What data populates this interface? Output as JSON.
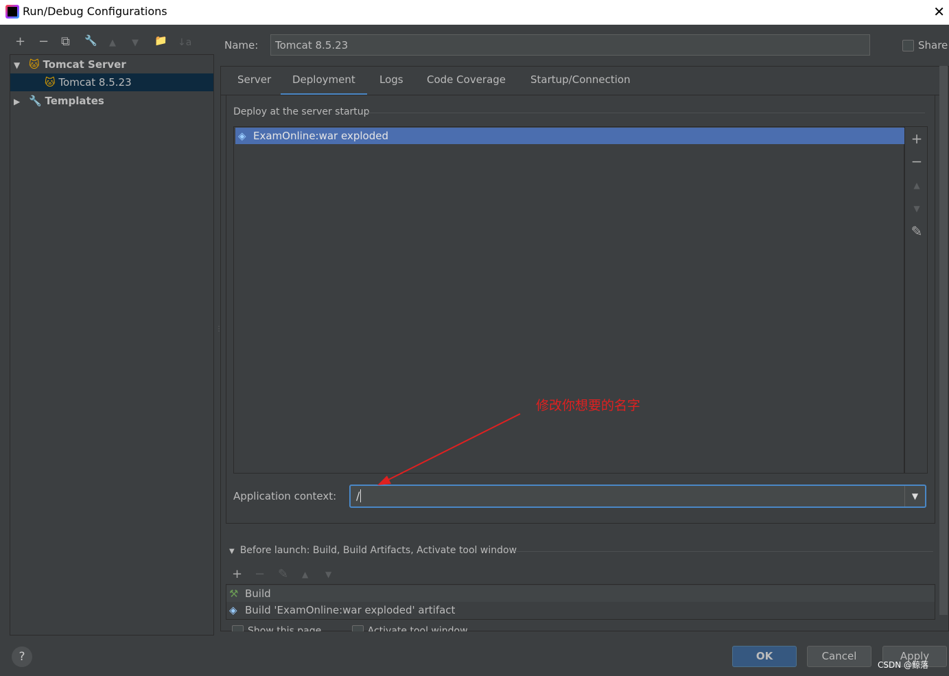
{
  "window": {
    "title": "Run/Debug Configurations",
    "close": "✕"
  },
  "toolbar": {
    "add": "+",
    "remove": "−",
    "copy": "⧉",
    "edit": "🔧",
    "up": "▲",
    "down": "▼",
    "folder": "📁",
    "sort": "↓a"
  },
  "tree": {
    "group": "Tomcat Server",
    "item": "Tomcat 8.5.23",
    "templates": "Templates"
  },
  "name": {
    "label": "Name:",
    "value": "Tomcat 8.5.23"
  },
  "share": {
    "label": "Share",
    "checked": false
  },
  "tabs": [
    "Server",
    "Deployment",
    "Logs",
    "Code Coverage",
    "Startup/Connection"
  ],
  "deployment": {
    "section": "Deploy at the server startup",
    "artifacts": [
      "ExamOnline:war exploded"
    ],
    "side": {
      "add": "+",
      "remove": "−",
      "up": "▲",
      "down": "▼",
      "edit": "✎"
    },
    "context_label": "Application context:",
    "context_value": "/"
  },
  "annotation": "修改你想要的名字",
  "before_launch": {
    "title": "Before launch: Build, Build Artifacts, Activate tool window",
    "items": [
      "Build",
      "Build 'ExamOnline:war exploded' artifact"
    ],
    "options": [
      "Show this page",
      "Activate tool window"
    ]
  },
  "buttons": {
    "help": "?",
    "ok": "OK",
    "cancel": "Cancel",
    "apply": "Apply"
  },
  "watermark": "CSDN @鲸落",
  "colors": {
    "selection": "#4b6eaf",
    "accent": "#4a88c7",
    "annotation": "#e02020",
    "ok": "#365880"
  }
}
